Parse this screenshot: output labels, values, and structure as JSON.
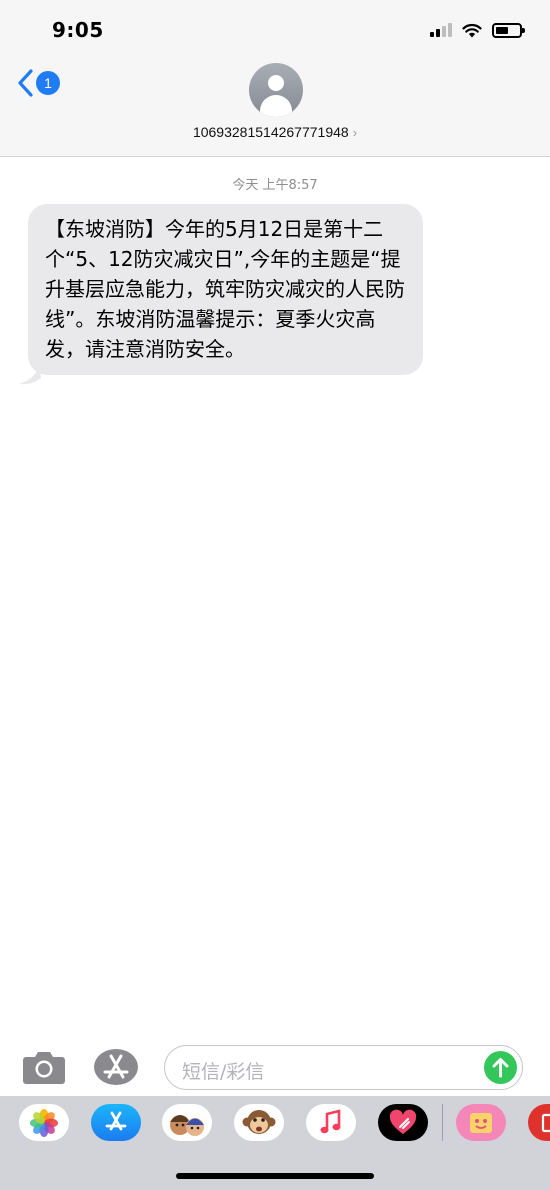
{
  "status_bar": {
    "time": "9:05",
    "icons": [
      "cellular-signal-icon",
      "wifi-icon",
      "battery-icon"
    ]
  },
  "nav": {
    "back_icon": "chevron-left-icon",
    "unread_count": "1",
    "contact_number": "10693281514267771948",
    "contact_chevron": "›"
  },
  "conversation": {
    "timestamp": "今天 上午8:57",
    "messages": [
      {
        "direction": "incoming",
        "text": "【东坡消防】今年的5月12日是第十二个“5、12防灾减灾日”,今年的主题是“提升基层应急能力，筑牢防灾减灾的人民防线”。东坡消防温馨提示：夏季火灾高发，请注意消防安全。"
      }
    ]
  },
  "composer": {
    "placeholder": "短信/彩信",
    "send_icon": "arrow-up-icon"
  },
  "app_drawer": {
    "apps": [
      "photos-app-icon",
      "app-store-app-icon",
      "memoji-app-icon",
      "animoji-monkey-app-icon",
      "music-app-icon",
      "digital-touch-app-icon",
      "stickers-app-icon",
      "partial-app-icon"
    ]
  },
  "colors": {
    "accent_blue": "#1f7cf5",
    "send_green": "#33c759",
    "bubble_gray": "#e9e9eb",
    "header_bg": "#f6f6f6",
    "drawer_bg": "#d1d3d9"
  }
}
